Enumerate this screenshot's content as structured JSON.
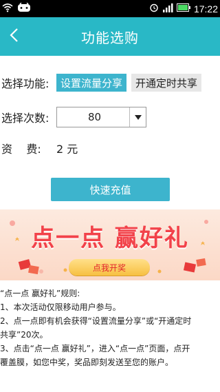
{
  "status_bar": {
    "time": "17:22",
    "icons": [
      "wifi-icon",
      "game-icon",
      "alarm-icon",
      "signal-icon",
      "battery-icon"
    ]
  },
  "header": {
    "title": "功能选购",
    "back_icon": "chevron-left-icon"
  },
  "function_row": {
    "label": "选择功能:",
    "options": [
      {
        "label": "设置流量分享",
        "selected": true
      },
      {
        "label": "开通定时共享",
        "selected": false
      }
    ]
  },
  "times_row": {
    "label": "选择次数:",
    "selected_value": "80"
  },
  "fee_row": {
    "label": "资    费:",
    "value": "2 元"
  },
  "recharge_button": "快速充值",
  "banner": {
    "title": "点一点 赢好礼",
    "button": "点我开奖"
  },
  "rules": {
    "title": "“点一点 赢好礼”规则:",
    "lines": [
      "1、本次活动仅限移动用户参与。",
      "2、点一点即有机会获得“设置流量分享”或“开通定时",
      "共享”20次。",
      "3、点击“点一点 赢好礼”，进入“点一点”页面，点开",
      "覆盖膜，如您中奖，奖品即刻发送至您的账户。"
    ]
  },
  "colors": {
    "header_bg": "#29b8c6",
    "accent": "#3db4cd",
    "banner_title": "#f2424a"
  }
}
